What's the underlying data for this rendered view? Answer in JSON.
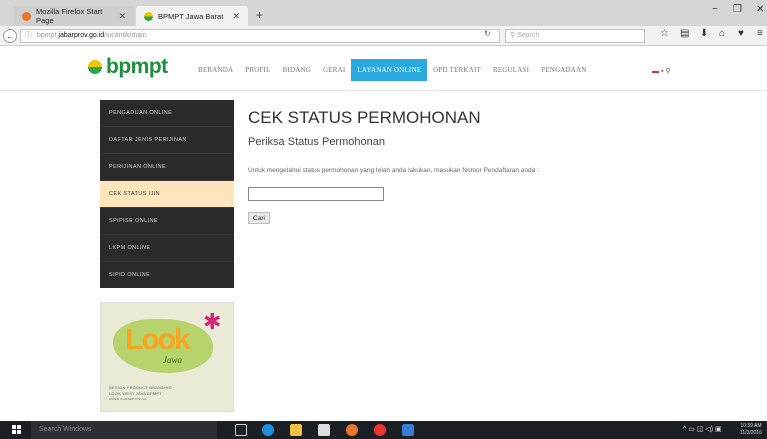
{
  "browser": {
    "tabs": [
      {
        "title": "Mozilla Firefox Start Page",
        "active": false
      },
      {
        "title": "BPMPT Jawa Barat",
        "active": true
      }
    ],
    "url_prefix": "bpmpt.",
    "url_domain": "jabarprov.go.id",
    "url_path": "/sicantik/main",
    "search_placeholder": "Search"
  },
  "site": {
    "logo_text": "bpmpt",
    "nav": [
      "BERANDA",
      "PROFIL",
      "BIDANG",
      "GERAI",
      "LAYANAN ONLINE",
      "OPD TERKAIT",
      "REGULASI",
      "PENGADAAN"
    ],
    "active_nav": "LAYANAN ONLINE"
  },
  "sidebar": {
    "items": [
      {
        "label": "PENGADUAN ONLINE"
      },
      {
        "label": "DAFTAR JENIS PERIJINAN"
      },
      {
        "label": "PERIJINAN ONLINE"
      },
      {
        "label": "CEK STATUS IJIN"
      },
      {
        "label": "SPIPISE ONLINE"
      },
      {
        "label": "LKPM ONLINE"
      },
      {
        "label": "SIPID ONLINE"
      }
    ],
    "active_index": 3
  },
  "banner": {
    "word": "Look",
    "script": "Jawa",
    "lines": [
      "DESIGN PRODUCT BRANDING",
      "LOOK WEST JAVA BPMPT",
      "VIDEO KONSEP VISUAL"
    ]
  },
  "main": {
    "title": "CEK STATUS PERMOHONAN",
    "subtitle": "Periksa Status Permohonan",
    "instruction": "Untuk mengetahui status permohonan yang telah anda lakukan, masukan Nomor Pendaftaran anda :",
    "input_value": "",
    "button_label": "Cari"
  },
  "taskbar": {
    "search_placeholder": "Search Windows",
    "time": "10:39 AM",
    "date": "11/3/2016"
  }
}
